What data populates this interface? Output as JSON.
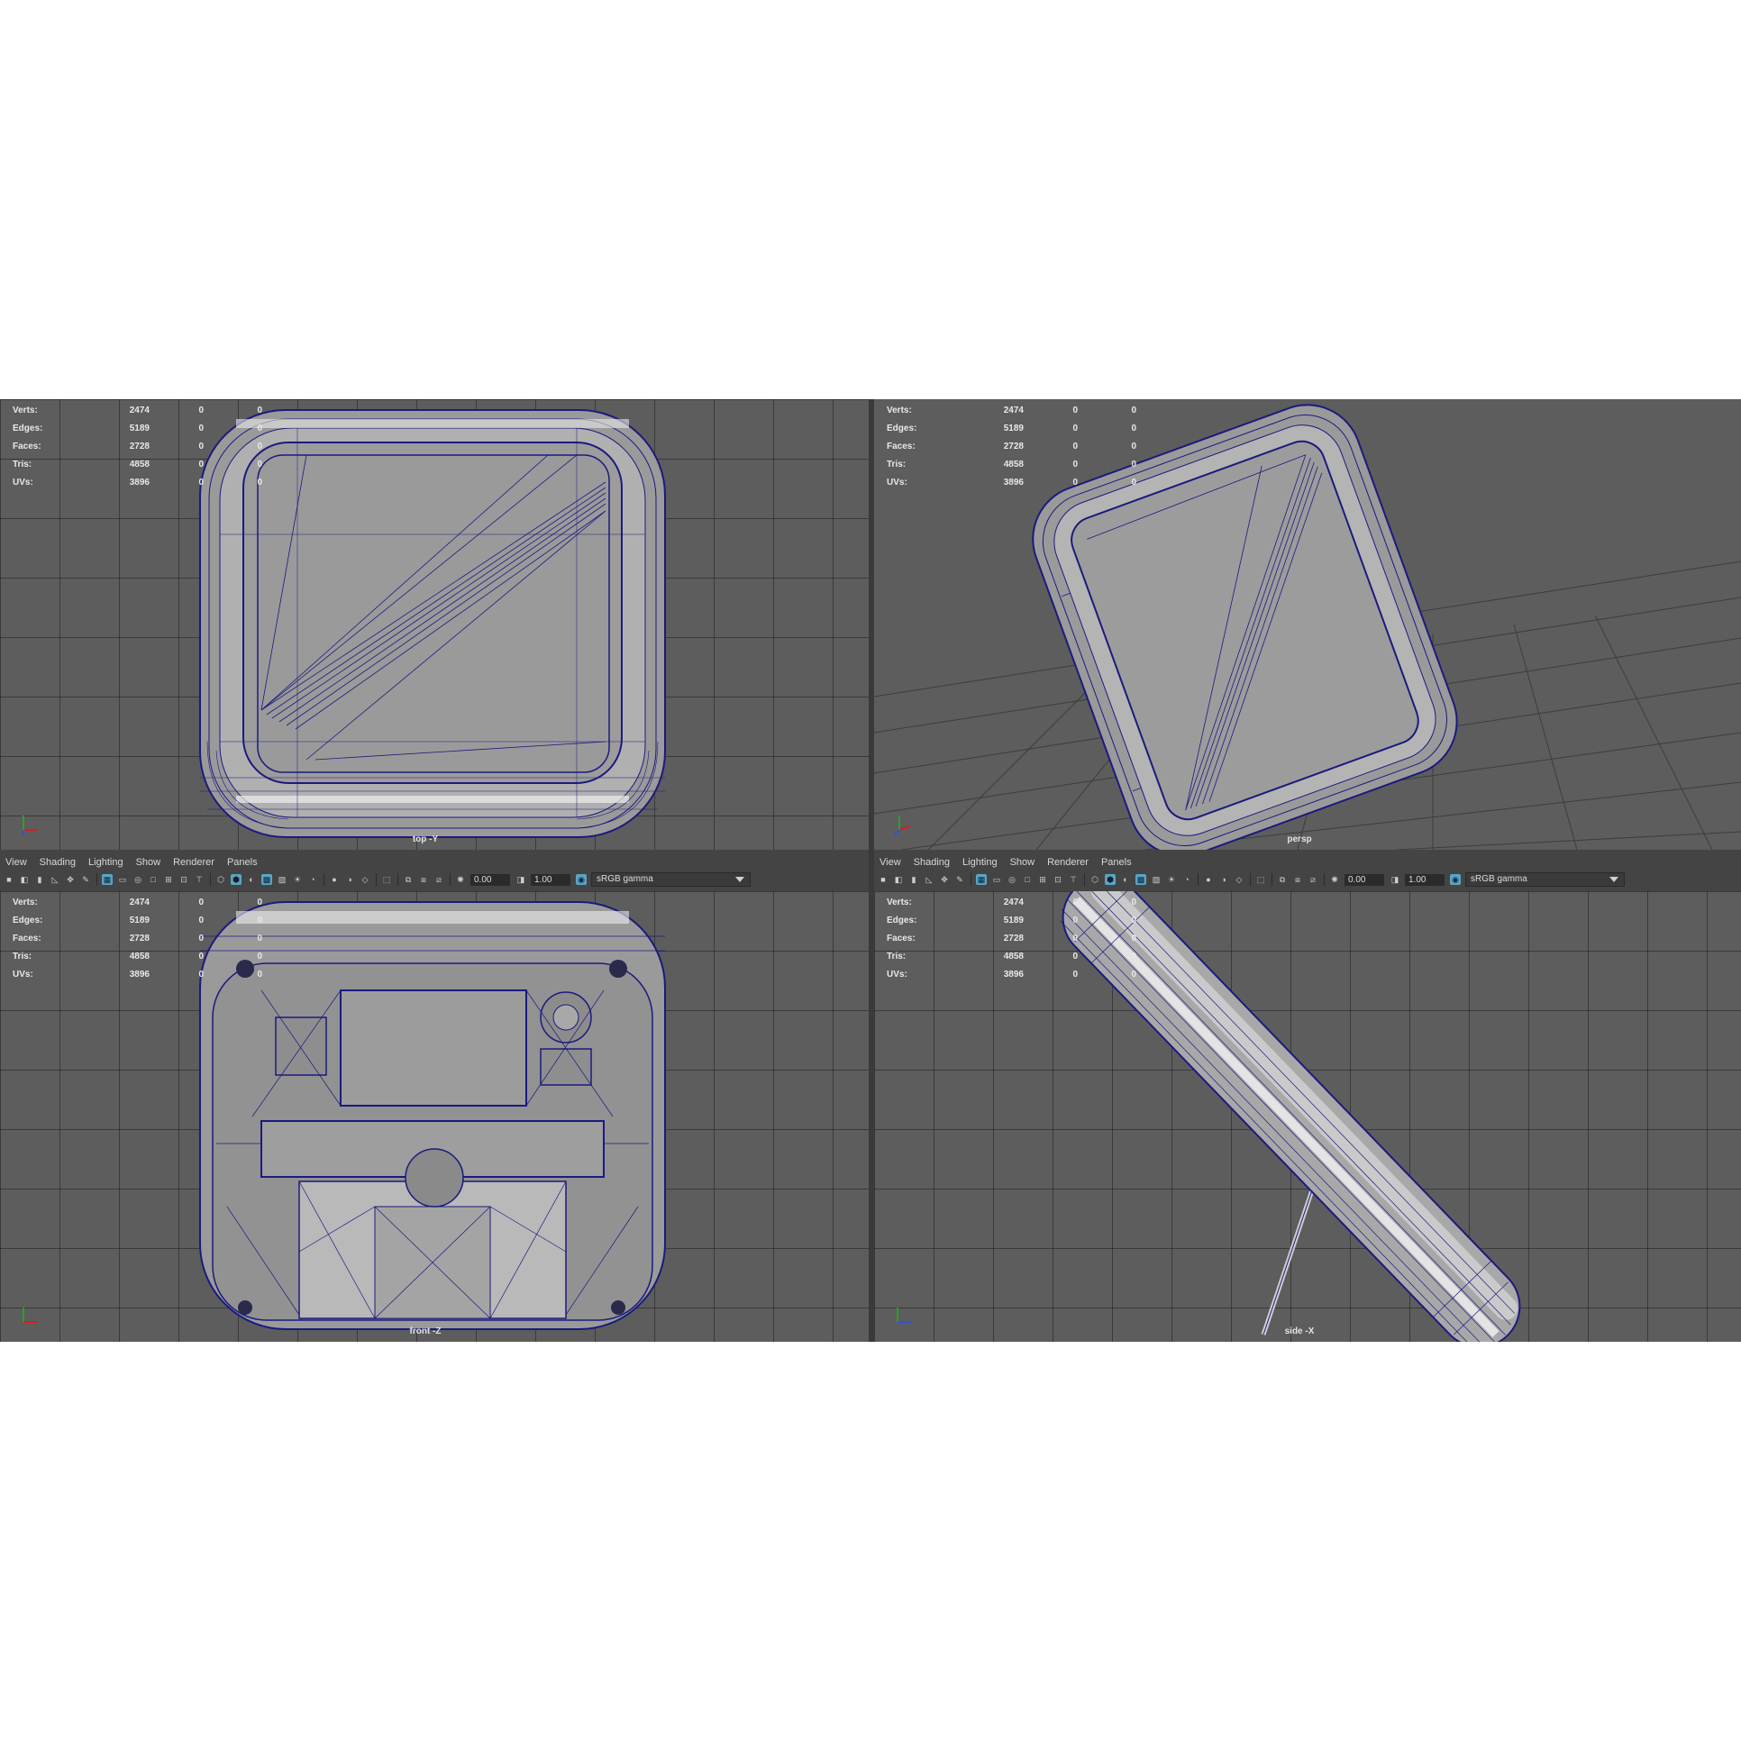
{
  "stats": {
    "rows": [
      {
        "label": "Verts:",
        "v1": "2474",
        "v2": "0",
        "v3": "0"
      },
      {
        "label": "Edges:",
        "v1": "5189",
        "v2": "0",
        "v3": "0"
      },
      {
        "label": "Faces:",
        "v1": "2728",
        "v2": "0",
        "v3": "0"
      },
      {
        "label": "Tris:",
        "v1": "4858",
        "v2": "0",
        "v3": "0"
      },
      {
        "label": "UVs:",
        "v1": "3896",
        "v2": "0",
        "v3": "0"
      }
    ]
  },
  "viewports": {
    "top": {
      "camera": "top -Y"
    },
    "persp": {
      "camera": "persp"
    },
    "front": {
      "camera": "front -Z"
    },
    "side": {
      "camera": "side -X"
    }
  },
  "panel_menu": [
    "View",
    "Shading",
    "Lighting",
    "Show",
    "Renderer",
    "Panels"
  ],
  "toolbar": {
    "exposure": "0.00",
    "gamma": "1.00",
    "color_space": "sRGB gamma"
  },
  "colors": {
    "viewport_bg": "#5d5d5d",
    "wire": "#1a1a80",
    "mesh": "#9c9c9c",
    "accent": "#58a6c7"
  }
}
